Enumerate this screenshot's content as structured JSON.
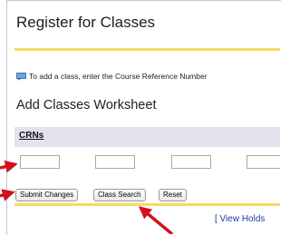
{
  "page": {
    "title": "Register for Classes",
    "info_text": "To add a class, enter the Course Reference Number"
  },
  "worksheet": {
    "heading": "Add Classes Worksheet",
    "crn_header": "CRNs",
    "crn_inputs": [
      "",
      "",
      "",
      ""
    ]
  },
  "buttons": {
    "submit_changes": "Submit Changes",
    "class_search": "Class Search",
    "reset": "Reset"
  },
  "links": {
    "view_holds": "[ View Holds"
  },
  "colors": {
    "accent_rule": "#f4dc63",
    "crn_header_bg": "#e3e3f0",
    "annotation_arrow": "#d0141c",
    "link": "#1a3c9e"
  },
  "icons": {
    "info": "info-note-icon",
    "annotation": "red-arrow-icon"
  }
}
